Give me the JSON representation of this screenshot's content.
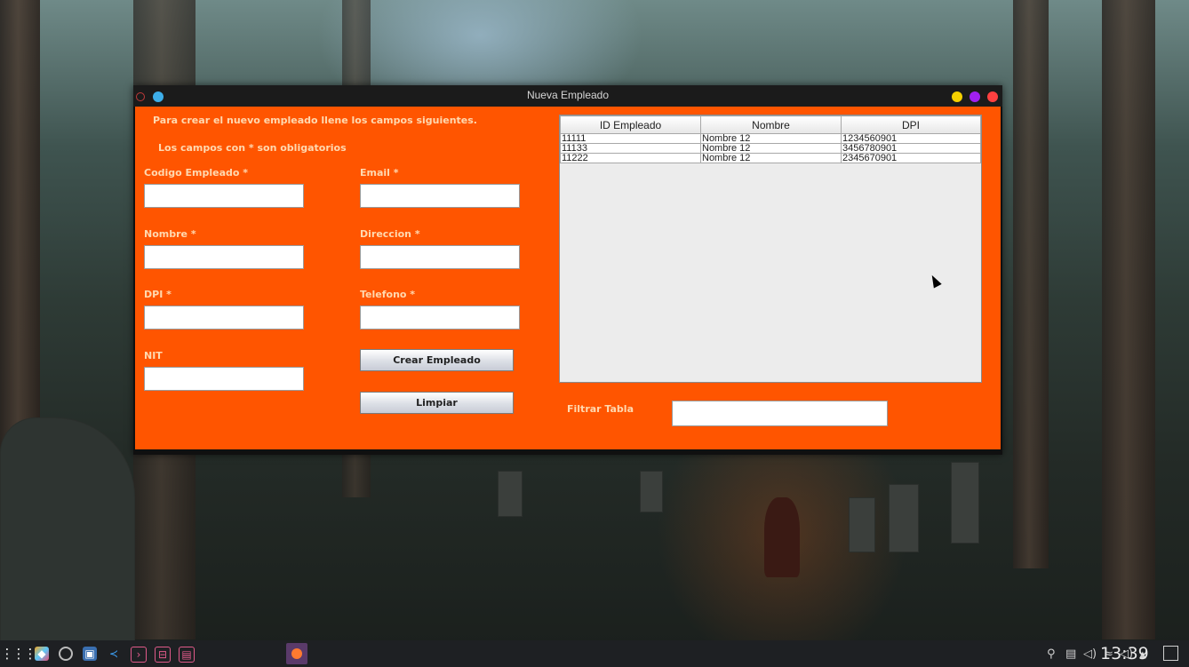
{
  "window": {
    "title": "Nueva Empleado",
    "accent": "#ff5500"
  },
  "form": {
    "intro_line1": "Para crear el nuevo empleado llene los campos siguientes.",
    "intro_line2": "Los campos con * son obligatorios",
    "codigo_label": "Codigo Empleado *",
    "codigo_value": "",
    "email_label": "Email *",
    "email_value": "",
    "nombre_label": "Nombre *",
    "nombre_value": "",
    "direccion_label": "Direccion *",
    "direccion_value": "",
    "dpi_label": "DPI *",
    "dpi_value": "",
    "telefono_label": "Telefono *",
    "telefono_value": "",
    "nit_label": "NIT",
    "nit_value": "",
    "crear_button": "Crear Empleado",
    "limpiar_button": "Limpiar"
  },
  "table": {
    "headers": [
      "ID Empleado",
      "Nombre",
      "DPI"
    ],
    "rows": [
      [
        "11111",
        "Nombre 12",
        "1234560901"
      ],
      [
        "11133",
        "Nombre 12",
        "3456780901"
      ],
      [
        "11222",
        "Nombre 12",
        "2345670901"
      ]
    ]
  },
  "filter": {
    "label": "Filtrar Tabla",
    "value": ""
  },
  "taskbar": {
    "clock": "13:39",
    "apps": [
      "app-launcher-icon",
      "app-cube-icon",
      "chrome-icon",
      "image-viewer-icon",
      "vscode-icon",
      "terminal-icon",
      "toolbox-icon",
      "files-icon",
      "active-app-icon"
    ],
    "tray": [
      "user-icon",
      "clipboard-icon",
      "volume-icon",
      "wifi-icon",
      "speaker-icon",
      "arrow-up-icon"
    ]
  }
}
